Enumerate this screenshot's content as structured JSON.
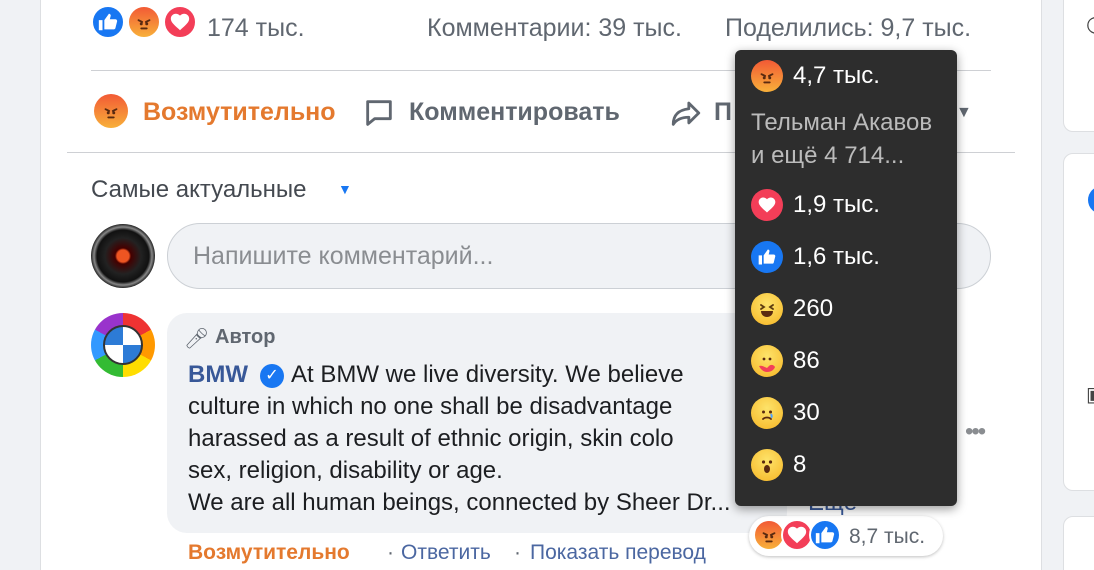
{
  "reactions_summary": {
    "count": "174 тыс.",
    "comments": "Комментарии: 39 тыс.",
    "shares": "Поделились: 9,7 тыс."
  },
  "actions": {
    "react_label": "Возмутительно",
    "comment_label": "Комментировать",
    "share_label": "П"
  },
  "sort": {
    "label": "Самые актуальные"
  },
  "comment_input": {
    "placeholder": "Напишите комментарий..."
  },
  "comment": {
    "badge": "Автор",
    "author": "BMW",
    "lines": [
      "At BMW we live diversity. We believe",
      "culture in which no one shall be disadvantage",
      "harassed as a result of ethnic origin, skin colo",
      "sex, religion, disability or age.",
      "We are all human beings, connected by Sheer Dr..."
    ],
    "more": "Ещё",
    "reaction_link": "Возмутительно",
    "reply": "Ответить",
    "translate": "Показать перевод",
    "reactions_count": "8,7 тыс."
  },
  "tooltip": {
    "angry": "4,7 тыс.",
    "names_line1": "Тельман Акавов",
    "names_line2": "и ещё 4 714...",
    "love": "1,9 тыс.",
    "like": "1,6 тыс.",
    "haha": "260",
    "care": "86",
    "sad": "30",
    "wow": "8"
  },
  "colors": {
    "angry_orange": "#e4792e",
    "facebook_blue": "#1877f2",
    "love_red": "#f33e58",
    "link_blue": "#385898"
  }
}
